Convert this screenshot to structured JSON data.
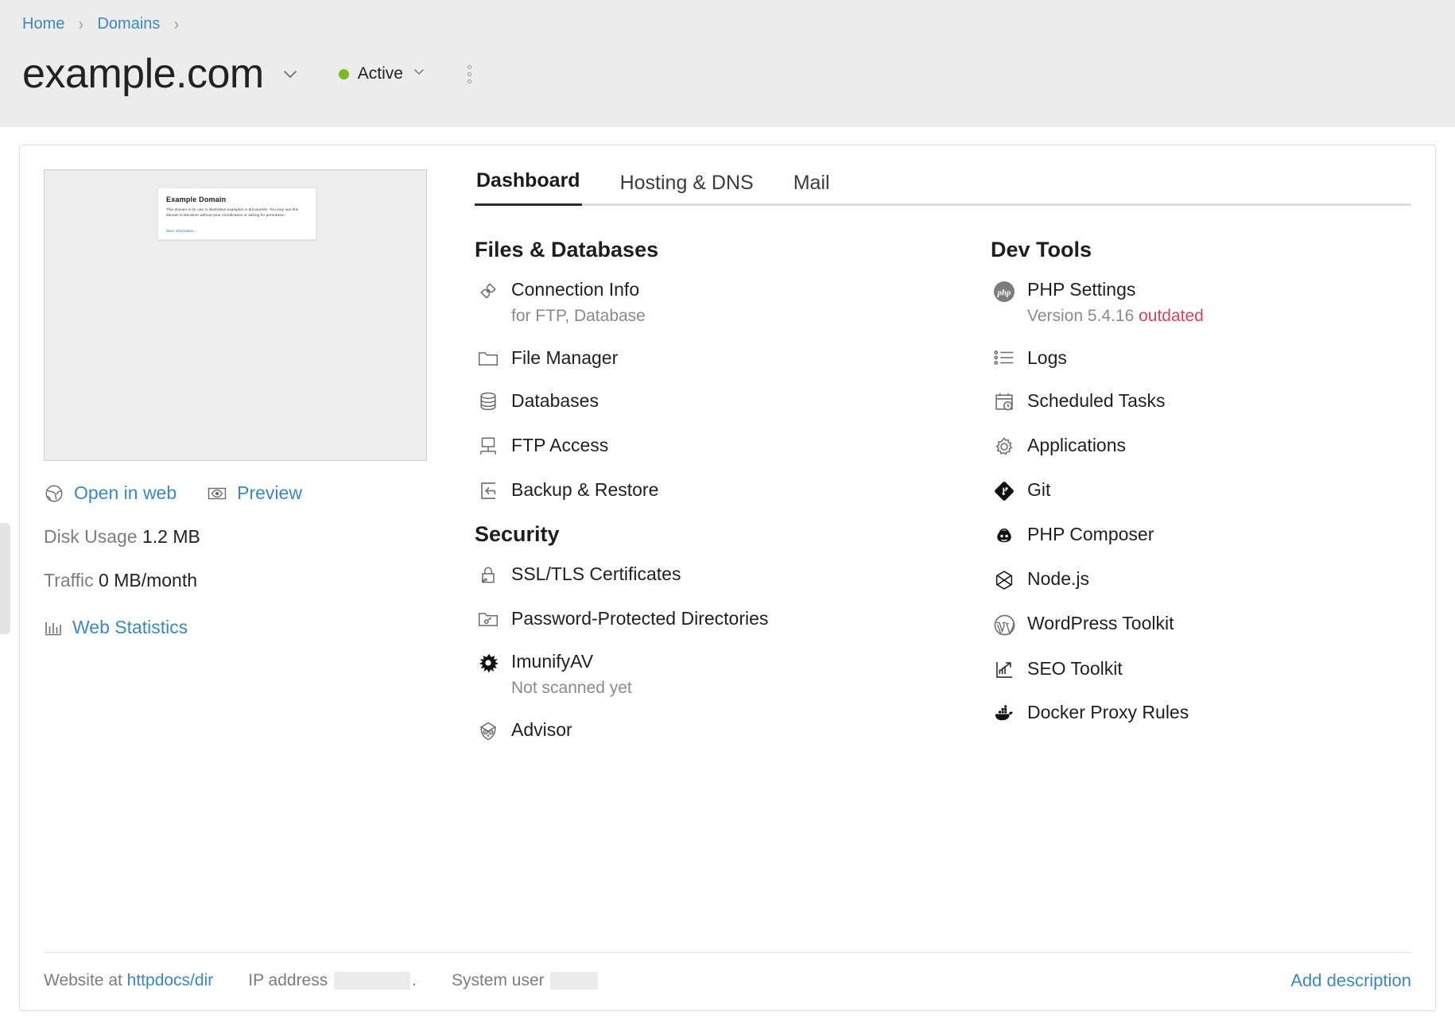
{
  "breadcrumb": {
    "items": [
      "Home",
      "Domains"
    ]
  },
  "header": {
    "domain": "example.com",
    "status": "Active",
    "status_color": "#7db921",
    "domain_caret_icon": "chevron-down-icon",
    "status_caret_icon": "chevron-down-icon",
    "more_icon": "kebab-menu-icon"
  },
  "preview": {
    "site_title": "Example Domain",
    "site_body": "This domain is for use in illustrative examples in documents. You may use this domain in literature without prior coordination or asking for permission.",
    "site_link": "More information...",
    "open_in_web": "Open in web",
    "open_in_web_icon": "globe-icon",
    "preview_label": "Preview",
    "preview_icon": "eye-icon"
  },
  "stats": {
    "disk_usage_label": "Disk Usage",
    "disk_usage_value": "1.2 MB",
    "traffic_label": "Traffic",
    "traffic_value": "0 MB/month",
    "web_statistics": "Web Statistics",
    "web_statistics_icon": "bar-chart-icon"
  },
  "tabs": [
    {
      "label": "Dashboard",
      "active": true
    },
    {
      "label": "Hosting & DNS",
      "active": false
    },
    {
      "label": "Mail",
      "active": false
    }
  ],
  "sections": {
    "files_databases": {
      "title": "Files & Databases",
      "items": [
        {
          "label": "Connection Info",
          "sub": "for FTP, Database",
          "icon": "plug-connection-icon"
        },
        {
          "label": "File Manager",
          "sub": "",
          "icon": "folder-icon"
        },
        {
          "label": "Databases",
          "sub": "",
          "icon": "database-icon"
        },
        {
          "label": "FTP Access",
          "sub": "",
          "icon": "ftp-server-icon"
        },
        {
          "label": "Backup & Restore",
          "sub": "",
          "icon": "backup-restore-icon"
        }
      ]
    },
    "security": {
      "title": "Security",
      "items": [
        {
          "label": "SSL/TLS Certificates",
          "sub": "",
          "icon": "lock-icon"
        },
        {
          "label": "Password-Protected Directories",
          "sub": "",
          "icon": "folder-key-icon"
        },
        {
          "label": "ImunifyAV",
          "sub": "Not scanned yet",
          "icon": "imunify-burst-icon"
        },
        {
          "label": "Advisor",
          "sub": "",
          "icon": "owl-icon"
        }
      ]
    },
    "dev_tools": {
      "title": "Dev Tools",
      "items": [
        {
          "label": "PHP Settings",
          "sub_prefix": "Version 5.4.16",
          "sub_warn": "outdated",
          "icon": "php-icon"
        },
        {
          "label": "Logs",
          "sub": "",
          "icon": "list-icon"
        },
        {
          "label": "Scheduled Tasks",
          "sub": "",
          "icon": "calendar-clock-icon"
        },
        {
          "label": "Applications",
          "sub": "",
          "icon": "gear-icon"
        },
        {
          "label": "Git",
          "sub": "",
          "icon": "git-icon"
        },
        {
          "label": "PHP Composer",
          "sub": "",
          "icon": "composer-icon"
        },
        {
          "label": "Node.js",
          "sub": "",
          "icon": "nodejs-icon"
        },
        {
          "label": "WordPress Toolkit",
          "sub": "",
          "icon": "wordpress-icon"
        },
        {
          "label": "SEO Toolkit",
          "sub": "",
          "icon": "seo-chart-icon"
        },
        {
          "label": "Docker Proxy Rules",
          "sub": "",
          "icon": "docker-icon"
        }
      ]
    }
  },
  "footer": {
    "website_at_label": "Website at",
    "website_at_value": "httpdocs/dir",
    "ip_label": "IP address",
    "ip_value": "",
    "system_user_label": "System user",
    "system_user_value": "",
    "add_description": "Add description"
  },
  "colors": {
    "link": "#3c88bd",
    "warn": "#d9435f",
    "status_active": "#7db921",
    "header_bg": "#ececec"
  }
}
